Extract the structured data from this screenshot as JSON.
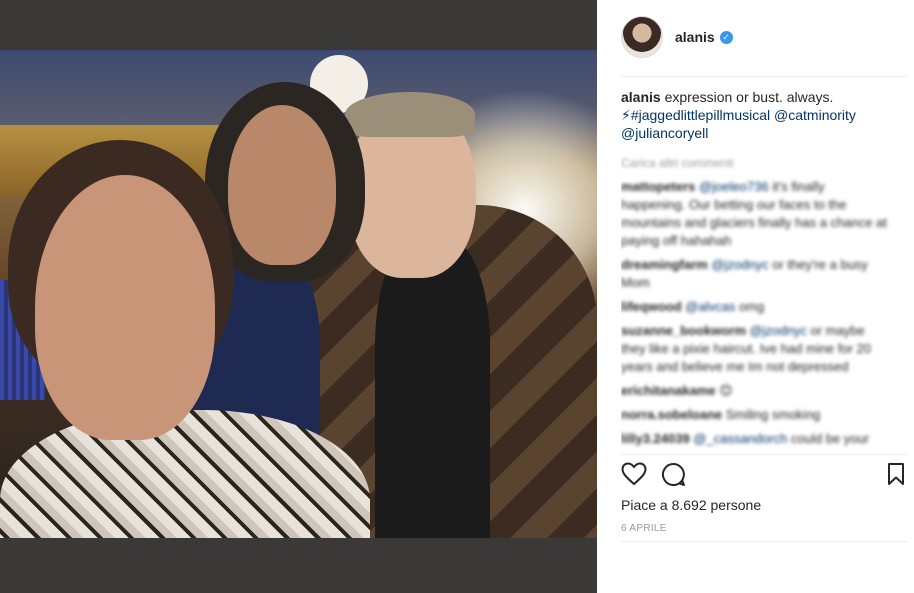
{
  "post": {
    "username": "alanis",
    "verified_symbol": "✓",
    "caption_user": "alanis",
    "caption_text": " expression or bust. always.",
    "caption_line2_prefix": "⚡#jaggedlittlepillmusical",
    "caption_mention1": " @catminority",
    "caption_mention2": "@juliancoryell",
    "load_more": "Carica altri commenti",
    "likes": "Piace a 8.692 persone",
    "date": "6 APRILE"
  },
  "comments": [
    {
      "user": "mattopeters",
      "mention": "@joeleo736",
      "text": " it's finally happening. Our betting our faces to the mountains and glaciers finally has a chance at paying off hahahah"
    },
    {
      "user": "dreamingfarm",
      "mention": "@jzodnyc",
      "text": " or they're a busy Mom"
    },
    {
      "user": "lifeqwood",
      "mention": "@alvcas",
      "text": " omg"
    },
    {
      "user": "suzanne_bookworm",
      "mention": "@jzodnyc",
      "text": " or maybe they like a pixie haircut. Ive had mine for 20 years and believe me Im not depressed"
    },
    {
      "user": "erichitanakame",
      "mention": "",
      "text": " 😊"
    },
    {
      "user": "norra.sobeloane",
      "mention": "",
      "text": " Smiling smoking"
    },
    {
      "user": "lilly3.24039",
      "mention": "@_cassandorch",
      "text": " could be your"
    }
  ],
  "icons": {
    "like": "heart-icon",
    "comment": "comment-icon",
    "save": "bookmark-icon"
  }
}
